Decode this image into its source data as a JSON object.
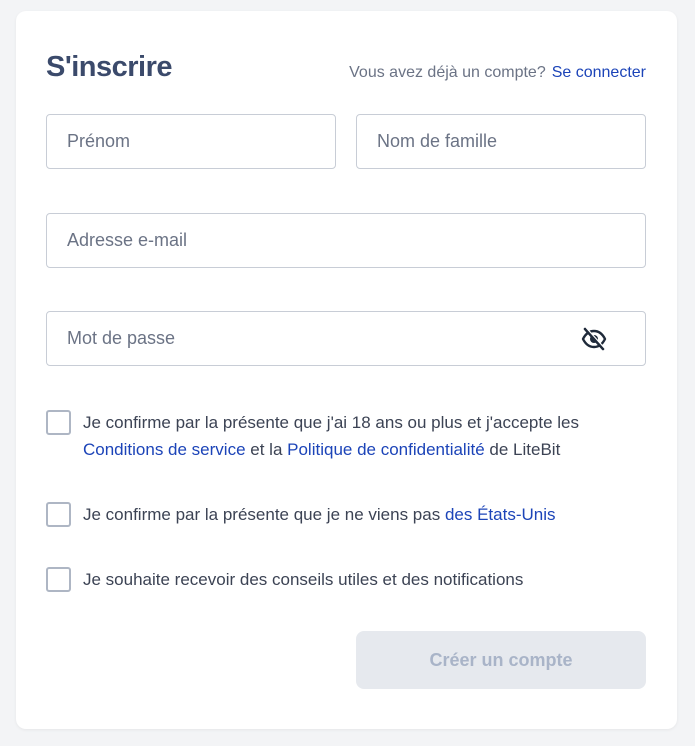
{
  "form": {
    "title": "S'inscrire",
    "login_prompt": "Vous avez déjà un compte?",
    "login_link": "Se connecter",
    "first_name": {
      "placeholder": "Prénom",
      "value": ""
    },
    "last_name": {
      "placeholder": "Nom de famille",
      "value": ""
    },
    "email": {
      "placeholder": "Adresse e-mail",
      "value": ""
    },
    "password": {
      "placeholder": "Mot de passe",
      "value": "",
      "toggle_icon": "eye-slash-icon"
    },
    "checks": {
      "terms": {
        "checked": false,
        "text_1": "Je confirme par la présente que j'ai 18 ans ou plus et j'accepte les",
        "link_terms": "Conditions de service",
        "text_2": "et la",
        "link_privacy": "Politique de confidentialité",
        "text_3": "de LiteBit"
      },
      "us": {
        "checked": false,
        "text": "Je confirme par la présente que je ne viens pas",
        "link": "des États-Unis"
      },
      "newsletter": {
        "checked": false,
        "text": "Je souhaite recevoir des conseils utiles et des notifications"
      }
    },
    "submit_label": "Créer un compte"
  },
  "colors": {
    "title": "#3b4a6b",
    "link": "#1c44b8",
    "button_bg_disabled": "#e6e9ee",
    "button_text_disabled": "#a9b4c8"
  }
}
